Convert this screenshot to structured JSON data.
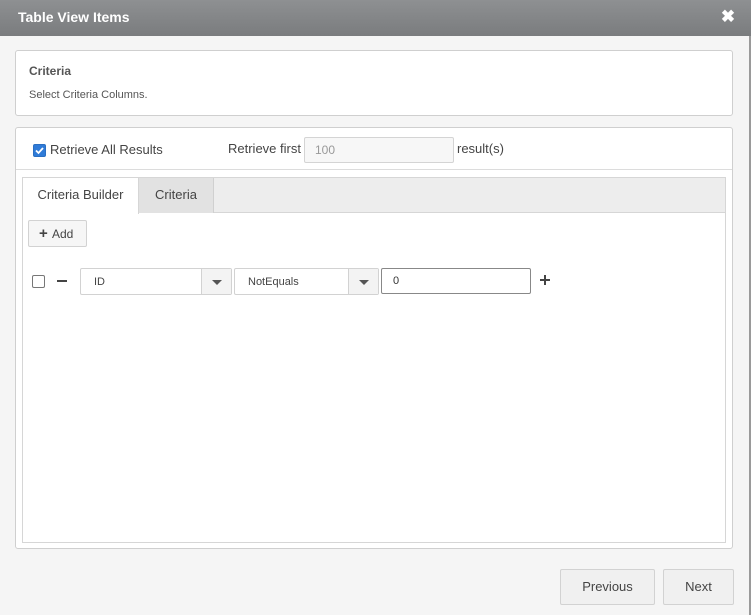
{
  "dialog": {
    "title": "Table View Items",
    "close_symbol": "✖"
  },
  "criteria_panel": {
    "heading": "Criteria",
    "description": "Select Criteria Columns."
  },
  "retrieve": {
    "all_label": "Retrieve All Results",
    "all_checked": true,
    "first_label": "Retrieve first",
    "first_value": "100",
    "results_label": "result(s)"
  },
  "tabs": [
    {
      "label": "Criteria Builder",
      "active": true
    },
    {
      "label": "Criteria",
      "active": false
    }
  ],
  "builder": {
    "add_label": "Add",
    "conditions": [
      {
        "checked": false,
        "field": "ID",
        "operator": "NotEquals",
        "value": "0"
      }
    ]
  },
  "footer": {
    "previous_label": "Previous",
    "next_label": "Next"
  },
  "colors": {
    "titlebar": "#7a7c7e",
    "checkbox_accent": "#2f7bd8"
  },
  "icons": [
    "close-icon",
    "checkmark-icon",
    "plus-icon",
    "minus-icon",
    "chevron-down-icon"
  ]
}
